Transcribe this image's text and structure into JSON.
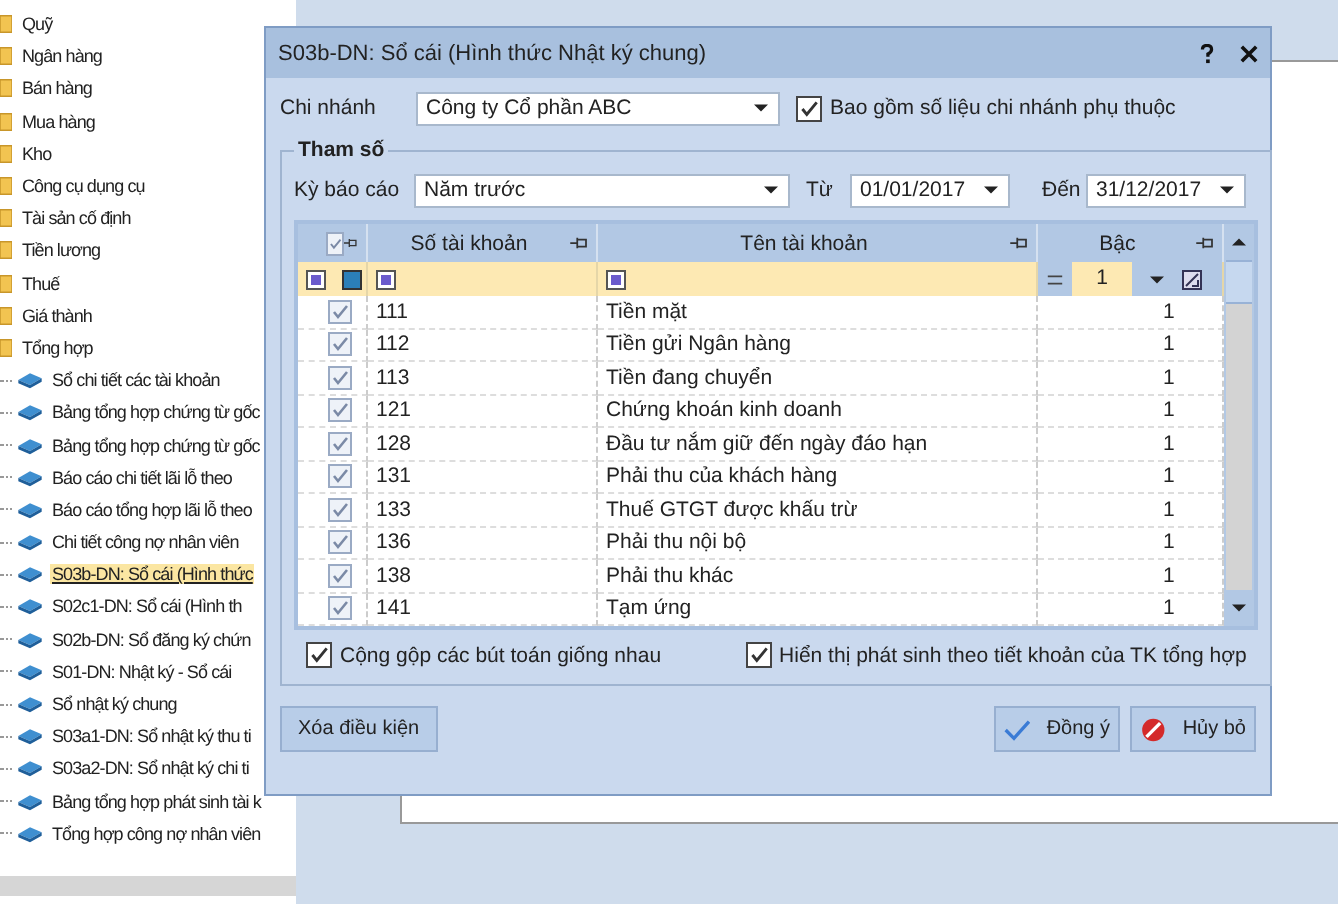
{
  "tree": [
    {
      "kind": "folder",
      "label": "Quỹ",
      "selected": false
    },
    {
      "kind": "folder",
      "label": "Ngân hàng",
      "selected": false
    },
    {
      "kind": "folder",
      "label": "Bán hàng",
      "selected": false
    },
    {
      "kind": "folder",
      "label": "Mua hàng",
      "selected": false
    },
    {
      "kind": "folder",
      "label": "Kho",
      "selected": false
    },
    {
      "kind": "folder",
      "label": "Công cụ dụng cụ",
      "selected": false
    },
    {
      "kind": "folder",
      "label": "Tài sản cố định",
      "selected": false
    },
    {
      "kind": "folder",
      "label": "Tiền lương",
      "selected": false
    },
    {
      "kind": "folder",
      "label": "Thuế",
      "selected": false
    },
    {
      "kind": "folder",
      "label": "Giá thành",
      "selected": false
    },
    {
      "kind": "folder",
      "label": "Tổng hợp",
      "selected": false
    },
    {
      "kind": "report",
      "label": "Sổ chi tiết các tài khoản",
      "selected": false
    },
    {
      "kind": "report",
      "label": "Bảng tổng hợp chứng từ gốc",
      "selected": false
    },
    {
      "kind": "report",
      "label": "Bảng tổng hợp chứng từ gốc",
      "selected": false
    },
    {
      "kind": "report",
      "label": "Báo cáo chi tiết lãi lỗ theo",
      "selected": false
    },
    {
      "kind": "report",
      "label": "Báo cáo tổng hợp lãi lỗ theo",
      "selected": false
    },
    {
      "kind": "report",
      "label": "Chi tiết công nợ nhân viên",
      "selected": false
    },
    {
      "kind": "report",
      "label": "S03b-DN: Sổ cái (Hình thức",
      "selected": true
    },
    {
      "kind": "report",
      "label": "S02c1-DN: Sổ cái (Hình th",
      "selected": false
    },
    {
      "kind": "report",
      "label": "S02b-DN: Sổ đăng ký chứn",
      "selected": false
    },
    {
      "kind": "report",
      "label": "S01-DN: Nhật ký - Sổ cái",
      "selected": false
    },
    {
      "kind": "report",
      "label": "Sổ nhật ký chung",
      "selected": false
    },
    {
      "kind": "report",
      "label": "S03a1-DN: Sổ nhật ký thu ti",
      "selected": false
    },
    {
      "kind": "report",
      "label": "S03a2-DN: Sổ nhật ký chi ti",
      "selected": false
    },
    {
      "kind": "report",
      "label": "Bảng tổng hợp phát sinh tài k",
      "selected": false
    },
    {
      "kind": "report",
      "label": "Tổng hợp công nợ nhân viên",
      "selected": false
    }
  ],
  "dialog": {
    "title": "S03b-DN: Sổ cái (Hình thức Nhật ký chung)",
    "branch": {
      "label": "Chi nhánh",
      "value": "Công ty Cổ phần ABC"
    },
    "include_dependent": {
      "label": "Bao gồm số liệu chi nhánh phụ thuộc",
      "checked": true
    },
    "params": {
      "legend": "Tham số",
      "period": {
        "label": "Kỳ báo cáo",
        "value": "Năm trước"
      },
      "from": {
        "label": "Từ",
        "value": "01/01/2017"
      },
      "to": {
        "label": "Đến",
        "value": "31/12/2017"
      }
    },
    "grid": {
      "all_checked": true,
      "columns": [
        "Số tài khoản",
        "Tên tài khoản",
        "Bậc"
      ],
      "level_filter": "1",
      "rows": [
        {
          "checked": true,
          "number": "111",
          "name": "Tiền mặt",
          "level": "1"
        },
        {
          "checked": true,
          "number": "112",
          "name": "Tiền gửi Ngân hàng",
          "level": "1"
        },
        {
          "checked": true,
          "number": "113",
          "name": "Tiền đang chuyển",
          "level": "1"
        },
        {
          "checked": true,
          "number": "121",
          "name": "Chứng khoán kinh doanh",
          "level": "1"
        },
        {
          "checked": true,
          "number": "128",
          "name": "Đầu tư nắm giữ đến ngày đáo hạn",
          "level": "1"
        },
        {
          "checked": true,
          "number": "131",
          "name": "Phải thu của khách hàng",
          "level": "1"
        },
        {
          "checked": true,
          "number": "133",
          "name": "Thuế GTGT được khấu trừ",
          "level": "1"
        },
        {
          "checked": true,
          "number": "136",
          "name": "Phải thu nội bộ",
          "level": "1"
        },
        {
          "checked": true,
          "number": "138",
          "name": "Phải thu khác",
          "level": "1"
        },
        {
          "checked": true,
          "number": "141",
          "name": "Tạm ứng",
          "level": "1"
        }
      ]
    },
    "options": [
      {
        "label": "Cộng gộp các bút toán giống nhau",
        "checked": true
      },
      {
        "label": "Hiển thị phát sinh theo tiết khoản của TK tổng hợp",
        "checked": true
      }
    ],
    "buttons": {
      "clear": "Xóa điều kiện",
      "ok": "Đồng ý",
      "cancel": "Hủy bỏ"
    }
  }
}
